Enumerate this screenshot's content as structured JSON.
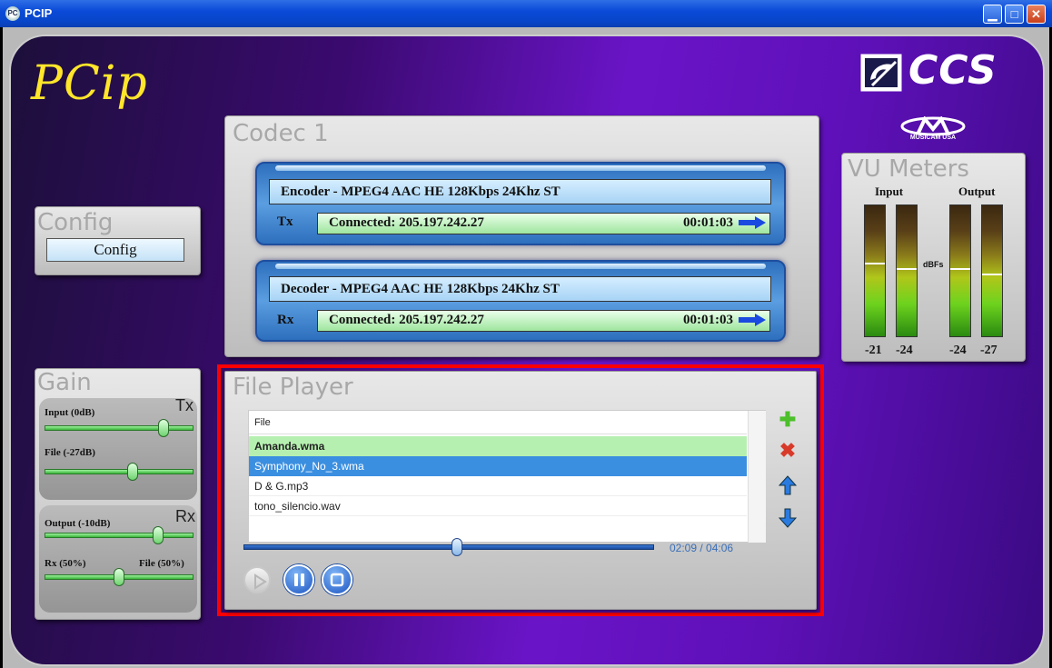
{
  "window": {
    "title": "PCIP",
    "app_icon_text": "PC"
  },
  "brand": {
    "app_logo_text": "PCip",
    "company_logo_text": "CCS",
    "company_sub_text": "MUSICAM USA"
  },
  "config": {
    "title": "Config",
    "button_label": "Config"
  },
  "codec": {
    "title": "Codec 1",
    "encoder": {
      "header": "Encoder -  MPEG4 AAC HE 128Kbps 24Khz ST",
      "dir_label": "Tx",
      "status": "Connected: 205.197.242.27",
      "time": "00:01:03"
    },
    "decoder": {
      "header": "Decoder -  MPEG4 AAC HE 128Kbps 24Khz ST",
      "dir_label": "Rx",
      "status": "Connected: 205.197.242.27",
      "time": "00:01:03"
    }
  },
  "vu": {
    "title": "VU Meters",
    "input_label": "Input",
    "output_label": "Output",
    "unit_label": "dBFs",
    "values": [
      "-21",
      "-24",
      "-24",
      "-27"
    ],
    "levels": [
      0.56,
      0.52,
      0.52,
      0.48
    ]
  },
  "gain": {
    "title": "Gain",
    "tx_tag": "Tx",
    "rx_tag": "Rx",
    "input_label": "Input (0dB)",
    "file_label": "File (-27dB)",
    "output_label": "Output (-10dB)",
    "rx_mix_label": "Rx (50%)",
    "file_mix_label": "File (50%)",
    "input_level": 0.82,
    "file_level": 0.6,
    "output_level": 0.78,
    "mix_level": 0.5
  },
  "player": {
    "title": "File Player",
    "column_header": "File",
    "files": [
      "Amanda.wma",
      "Symphony_No_3.wma",
      "D & G.mp3",
      "tono_silencio.wav"
    ],
    "position_time": "02:09 / 04:06",
    "position_fraction": 0.52
  },
  "colors": {
    "highlight": "#ff0000",
    "playing_row": "#b6f0b0",
    "selected_row": "#3b8fe0"
  }
}
